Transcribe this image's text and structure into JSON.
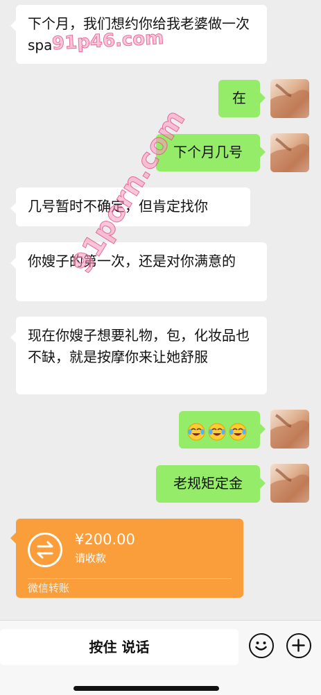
{
  "messages": {
    "m1": {
      "text": "下个月，我们想约你给我老婆做一次spa",
      "side": "left"
    },
    "m2": {
      "text": "在",
      "side": "right"
    },
    "m3": {
      "text": "下个月几号",
      "side": "right"
    },
    "m4": {
      "text": "几号暂时不确定，但肯定找你",
      "side": "left"
    },
    "m5": {
      "text": "你嫂子的第一次，还是对你满意的",
      "side": "left"
    },
    "m6": {
      "text": "现在你嫂子想要礼物，包，化妆品也不缺，就是按摩你来让她舒服",
      "side": "left"
    },
    "m7": {
      "emoji": "laughing-crying x3",
      "side": "right"
    },
    "m8": {
      "text": "老规矩定金",
      "side": "right"
    }
  },
  "transfer": {
    "amount": "¥200.00",
    "status": "请收款",
    "footer": "微信转账",
    "color": "#fa9d3b"
  },
  "watermark": {
    "top": "91p46.com",
    "diagonal": "91porn.com"
  },
  "bottom_bar": {
    "talk_label": "按住 说话",
    "emoji_icon": "smiley-icon",
    "plus_icon": "plus-icon"
  },
  "colors": {
    "background": "#ededed",
    "sent_bubble": "#95ec69",
    "received_bubble": "#ffffff"
  }
}
